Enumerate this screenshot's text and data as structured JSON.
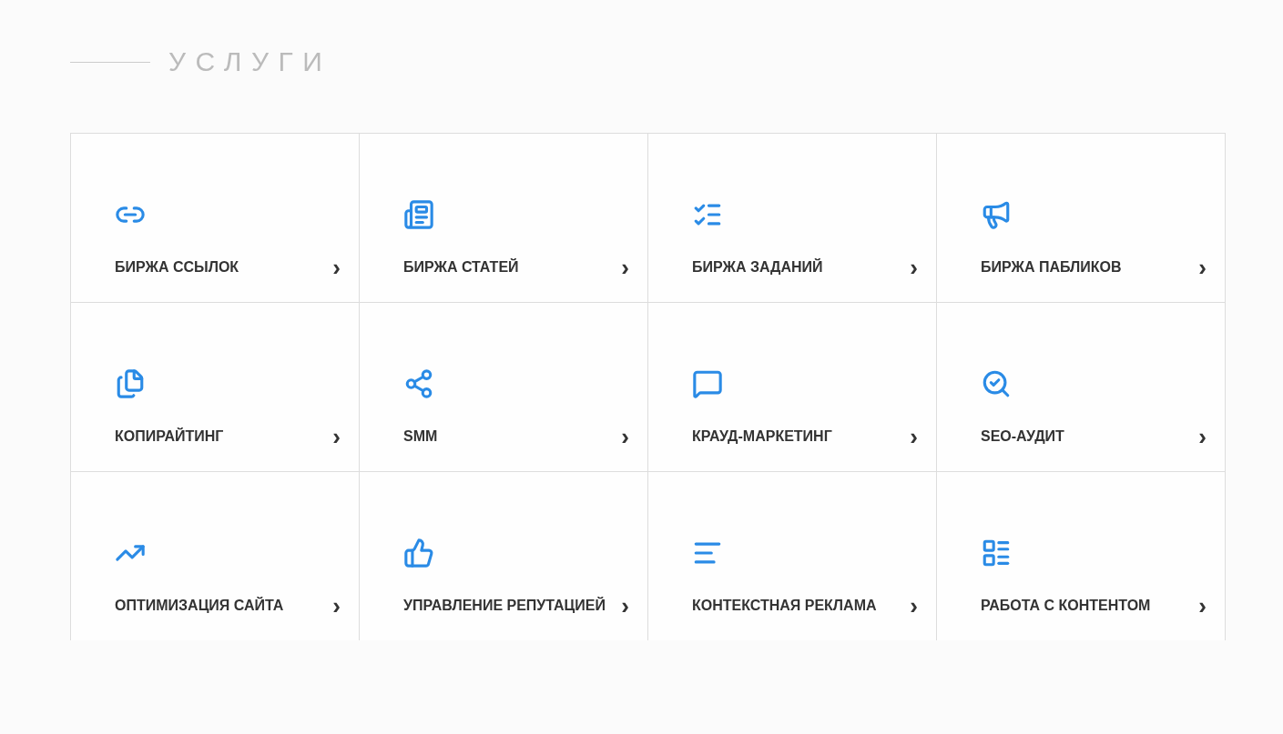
{
  "section_title": "УСЛУГИ",
  "services": [
    {
      "label": "БИРЖА ССЫЛОК",
      "arrow": "›"
    },
    {
      "label": "БИРЖА СТАТЕЙ",
      "arrow": "›"
    },
    {
      "label": "БИРЖА ЗАДАНИЙ",
      "arrow": "›"
    },
    {
      "label": "БИРЖА ПАБЛИКОВ",
      "arrow": "›"
    },
    {
      "label": "КОПИРАЙТИНГ",
      "arrow": "›"
    },
    {
      "label": "SMM",
      "arrow": "›"
    },
    {
      "label": "КРАУД-МАРКЕТИНГ",
      "arrow": "›"
    },
    {
      "label": "SEO-АУДИТ",
      "arrow": "›"
    },
    {
      "label": "ОПТИМИЗАЦИЯ САЙТА",
      "arrow": "›"
    },
    {
      "label": "УПРАВЛЕНИЕ РЕПУТАЦИЕЙ",
      "arrow": "›"
    },
    {
      "label": "КОНТЕКСТНАЯ РЕКЛАМА",
      "arrow": "›"
    },
    {
      "label": "РАБОТА С КОНТЕНТОМ",
      "arrow": "›"
    }
  ]
}
